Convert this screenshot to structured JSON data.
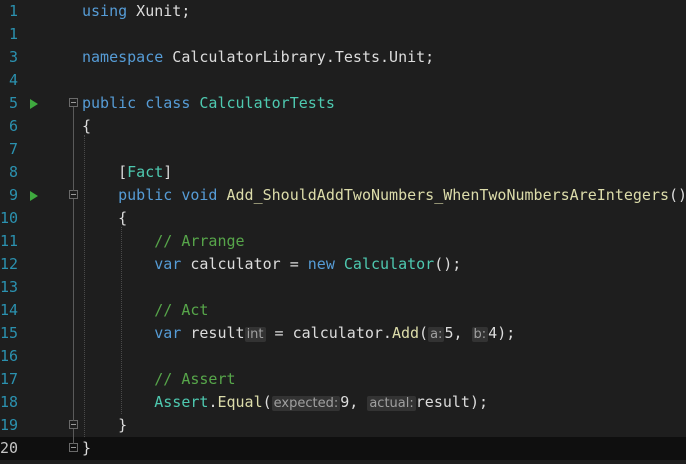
{
  "editor": {
    "current_line": 20,
    "colors": {
      "background": "#1e1e1e",
      "keyword": "#569cd6",
      "type": "#4ec9b0",
      "method": "#dcdcaa",
      "comment": "#57a64a",
      "line_number": "#2b91af",
      "run_icon": "#3fa93f"
    },
    "lines": [
      {
        "num": "1",
        "parts": [
          [
            "using",
            "k"
          ],
          [
            " Xunit;",
            ""
          ]
        ]
      },
      {
        "num": "1",
        "parts": []
      },
      {
        "num": "3",
        "parts": [
          [
            "namespace",
            "k"
          ],
          [
            " CalculatorLibrary.Tests.Unit;",
            ""
          ]
        ]
      },
      {
        "num": "4",
        "parts": []
      },
      {
        "num": "5",
        "run": true,
        "fold": "start",
        "parts": [
          [
            "public",
            "k"
          ],
          [
            " ",
            ""
          ],
          [
            "class",
            "k"
          ],
          [
            " ",
            ""
          ],
          [
            "CalculatorTests",
            "t"
          ]
        ]
      },
      {
        "num": "6",
        "parts": [
          [
            "{",
            ""
          ]
        ]
      },
      {
        "num": "7",
        "parts": []
      },
      {
        "num": "8",
        "parts": [
          [
            "    [",
            ""
          ],
          [
            "Fact",
            "t"
          ],
          [
            "]",
            ""
          ]
        ]
      },
      {
        "num": "9",
        "run": true,
        "fold": "start",
        "parts": [
          [
            "    ",
            ""
          ],
          [
            "public",
            "k"
          ],
          [
            " ",
            ""
          ],
          [
            "void",
            "k"
          ],
          [
            " ",
            ""
          ],
          [
            "Add_ShouldAddTwoNumbers_WhenTwoNumbersAreIntegers",
            "m"
          ],
          [
            "()",
            ""
          ]
        ]
      },
      {
        "num": "10",
        "parts": [
          [
            "    {",
            ""
          ]
        ]
      },
      {
        "num": "11",
        "parts": [
          [
            "        ",
            ""
          ],
          [
            "// Arrange",
            "c"
          ]
        ]
      },
      {
        "num": "12",
        "parts": [
          [
            "        ",
            ""
          ],
          [
            "var",
            "k"
          ],
          [
            " calculator = ",
            ""
          ],
          [
            "new",
            "k"
          ],
          [
            " ",
            ""
          ],
          [
            "Calculator",
            "t"
          ],
          [
            "();",
            ""
          ]
        ]
      },
      {
        "num": "13",
        "parts": []
      },
      {
        "num": "14",
        "parts": [
          [
            "        ",
            ""
          ],
          [
            "// Act",
            "c"
          ]
        ]
      },
      {
        "num": "15",
        "parts": [
          [
            "        ",
            ""
          ],
          [
            "var",
            "k"
          ],
          [
            " result",
            ""
          ],
          [
            "int",
            "hint"
          ],
          [
            " = calculator.",
            ""
          ],
          [
            "Add",
            "m"
          ],
          [
            "(",
            ""
          ],
          [
            "a:",
            "hint"
          ],
          [
            "5, ",
            ""
          ],
          [
            "b:",
            "hint"
          ],
          [
            "4);",
            ""
          ]
        ]
      },
      {
        "num": "16",
        "parts": []
      },
      {
        "num": "17",
        "parts": [
          [
            "        ",
            ""
          ],
          [
            "// Assert",
            "c"
          ]
        ]
      },
      {
        "num": "18",
        "parts": [
          [
            "        ",
            ""
          ],
          [
            "Assert",
            "t"
          ],
          [
            ".",
            ""
          ],
          [
            "Equal",
            "m"
          ],
          [
            "(",
            ""
          ],
          [
            "expected:",
            "hint"
          ],
          [
            "9, ",
            ""
          ],
          [
            "actual:",
            "hint"
          ],
          [
            "result);",
            ""
          ]
        ]
      },
      {
        "num": "19",
        "fold": "end",
        "parts": [
          [
            "    }",
            ""
          ]
        ]
      },
      {
        "num": "20",
        "fold": "end",
        "parts": [
          [
            "}",
            ""
          ]
        ]
      }
    ]
  }
}
